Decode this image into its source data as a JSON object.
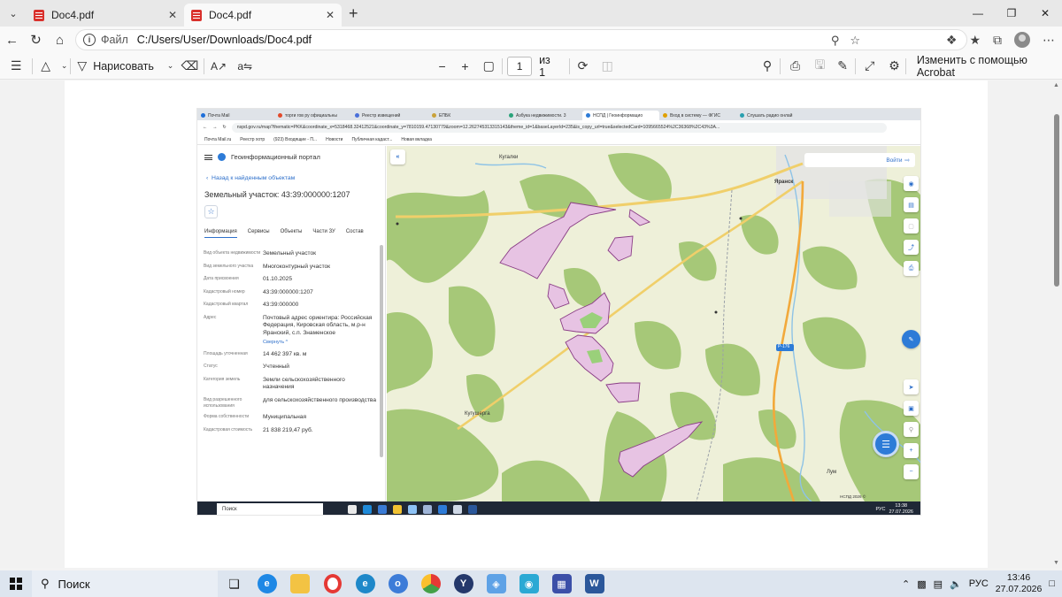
{
  "browser": {
    "tabs": [
      {
        "title": "Doc4.pdf",
        "active": false
      },
      {
        "title": "Doc4.pdf",
        "active": true
      }
    ],
    "address": {
      "scheme_label": "Файл",
      "url": "C:/Users/User/Downloads/Doc4.pdf"
    }
  },
  "pdf_toolbar": {
    "draw_label": "Нарисовать",
    "page_current": "1",
    "page_total": "из 1",
    "acrobat_label": "Изменить с помощью Acrobat"
  },
  "embedded": {
    "tabs": [
      {
        "title": "Почта Mail",
        "color": "#1e6fd9"
      },
      {
        "title": "торги гов ру официальны",
        "color": "#e24a2b"
      },
      {
        "title": "Реестр извещений",
        "color": "#4a6fd9"
      },
      {
        "title": "ЕПБК",
        "color": "#c9a23a"
      },
      {
        "title": "Азбука недвижимости. 3",
        "color": "#2aa37a"
      },
      {
        "title": "НСПД | Геоинформацио",
        "color": "#2d7bd7"
      },
      {
        "title": "Вход в систему — ФГИС",
        "color": "#e0a000"
      },
      {
        "title": "Слушать радио онлай",
        "color": "#2aa0b0"
      }
    ],
    "url": "nspd.gov.ru/map?thematic=PKK&coordinate_x=5318468.32412521&coordinate_y=7810159.47130779&zoom=12.262745313315143&theme_id=1&baseLayerId=235&is_copy_url=true&selectedCard=1095665524%2C36368%2C43%3A...",
    "bookmarks": [
      "Почта Mail.ru",
      "Реестр хотр",
      "(923) Входящие - П...",
      "Новости",
      "Публичная кадаст...",
      "Новая вкладка"
    ],
    "portal_title": "Геоинформационный портал",
    "back_link": "Назад к найденным объектам",
    "parcel_title": "Земельный участок: 43:39:000000:1207",
    "panel_tabs": [
      "Информация",
      "Сервисы",
      "Объекты",
      "Части ЗУ",
      "Состав"
    ],
    "fields": [
      {
        "key": "Вид объекта недвижимости",
        "value": "Земельный участок"
      },
      {
        "key": "Вид земельного участка",
        "value": "Многоконтурный участок"
      },
      {
        "key": "Дата присвоения",
        "value": "01.10.2025"
      },
      {
        "key": "Кадастровый номер",
        "value": "43:39:000000:1207"
      },
      {
        "key": "Кадастровый квартал",
        "value": "43:39:000000"
      },
      {
        "key": "Адрес",
        "value": "Почтовый адрес ориентира: Российская Федерация, Кировская область, м.р-н Яранский, с.п. Знаменское",
        "link": "Свернуть ^"
      },
      {
        "key": "Площадь уточненная",
        "value": "14 462 397 кв. м"
      },
      {
        "key": "Статус",
        "value": "Учтенный"
      },
      {
        "key": "Категория земель",
        "value": "Земли сельскохозяйственного назначения"
      },
      {
        "key": "Вид разрешенного использования",
        "value": "для сельскохозяйственного производства"
      },
      {
        "key": "Форма собственности",
        "value": "Муниципальная"
      },
      {
        "key": "Кадастровая стоимость",
        "value": "21 838 219,47 руб."
      }
    ],
    "map": {
      "login": "Войти",
      "labels": [
        "Кугалки",
        "Яранск",
        "Кугушерга",
        "Р-176",
        "Лум"
      ],
      "copyright": "НСПД 2026 ©"
    },
    "taskbar": {
      "search": "Поиск",
      "lang": "РУС",
      "time": "13:38",
      "date": "27.07.2026"
    }
  },
  "taskbar": {
    "search_label": "Поиск",
    "lang": "РУС",
    "time": "13:46",
    "date": "27.07.2026"
  },
  "colors": {
    "accent": "#2d6fca",
    "parcel_fill": "#e7c3e3",
    "parcel_stroke": "#8a3d86",
    "forest": "#9bc46b"
  }
}
